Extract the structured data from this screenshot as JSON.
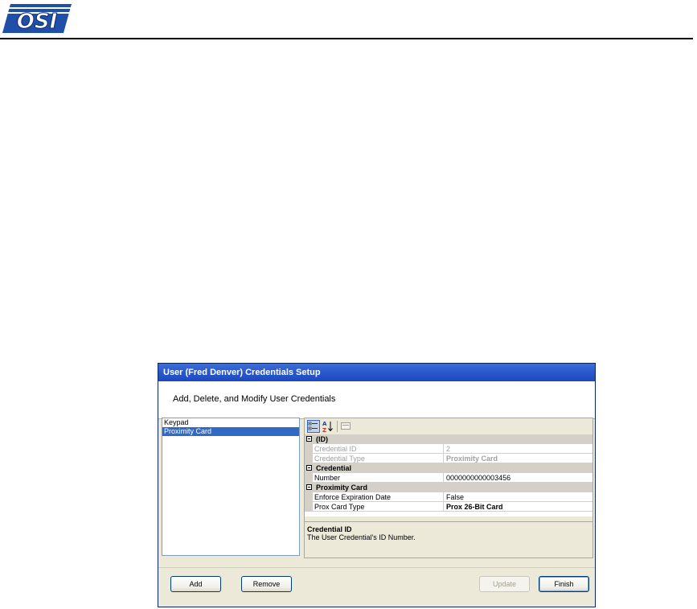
{
  "page": {
    "logo_text": "OSI",
    "logo_color": "#1f4fa8"
  },
  "dialog": {
    "title": "User (Fred Denver) Credentials Setup",
    "header_text": "Add, Delete, and Modify User Credentials",
    "credentials_list": [
      {
        "label": "Keypad",
        "selected": false
      },
      {
        "label": "Proximity Card",
        "selected": true
      }
    ],
    "property_grid": {
      "toolbar": {
        "categorized_icon": "categorized-icon",
        "alphabetical_icon": "alphabetical-sort-icon",
        "property_pages_icon": "property-pages-icon"
      },
      "categories": [
        {
          "name": "(ID)",
          "rows": [
            {
              "name": "Credential ID",
              "value": "2",
              "readonly": true,
              "bold": false
            },
            {
              "name": "Credential Type",
              "value": "Proximity Card",
              "readonly": true,
              "bold": true
            }
          ]
        },
        {
          "name": "Credential",
          "rows": [
            {
              "name": "Number",
              "value": "0000000000003456",
              "readonly": false,
              "bold": false
            }
          ]
        },
        {
          "name": "Proximity Card",
          "rows": [
            {
              "name": "Enforce Expiration Date",
              "value": "False",
              "readonly": false,
              "bold": false
            },
            {
              "name": "Prox Card Type",
              "value": "Prox 26-Bit Card",
              "readonly": false,
              "bold": true
            }
          ]
        }
      ],
      "description": {
        "title": "Credential ID",
        "text": "The User Credential's ID Number."
      }
    },
    "buttons": {
      "add": "Add",
      "remove": "Remove",
      "update": "Update",
      "finish": "Finish"
    }
  }
}
